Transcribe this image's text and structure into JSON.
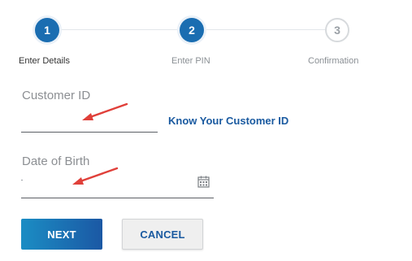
{
  "stepper": {
    "steps": [
      {
        "number": "1",
        "label": "Enter Details",
        "state": "active"
      },
      {
        "number": "2",
        "label": "Enter PIN",
        "state": "active"
      },
      {
        "number": "3",
        "label": "Confirmation",
        "state": "pending"
      }
    ]
  },
  "form": {
    "customer_id": {
      "label": "Customer ID",
      "value": "",
      "help_link": "Know Your Customer ID"
    },
    "date_of_birth": {
      "label": "Date of Birth",
      "value": "",
      "icon": "calendar-icon"
    }
  },
  "buttons": {
    "next": "NEXT",
    "cancel": "CANCEL"
  },
  "colors": {
    "accent": "#1a6db1",
    "link": "#1a5aa0",
    "annotation_arrow": "#e0403a"
  }
}
